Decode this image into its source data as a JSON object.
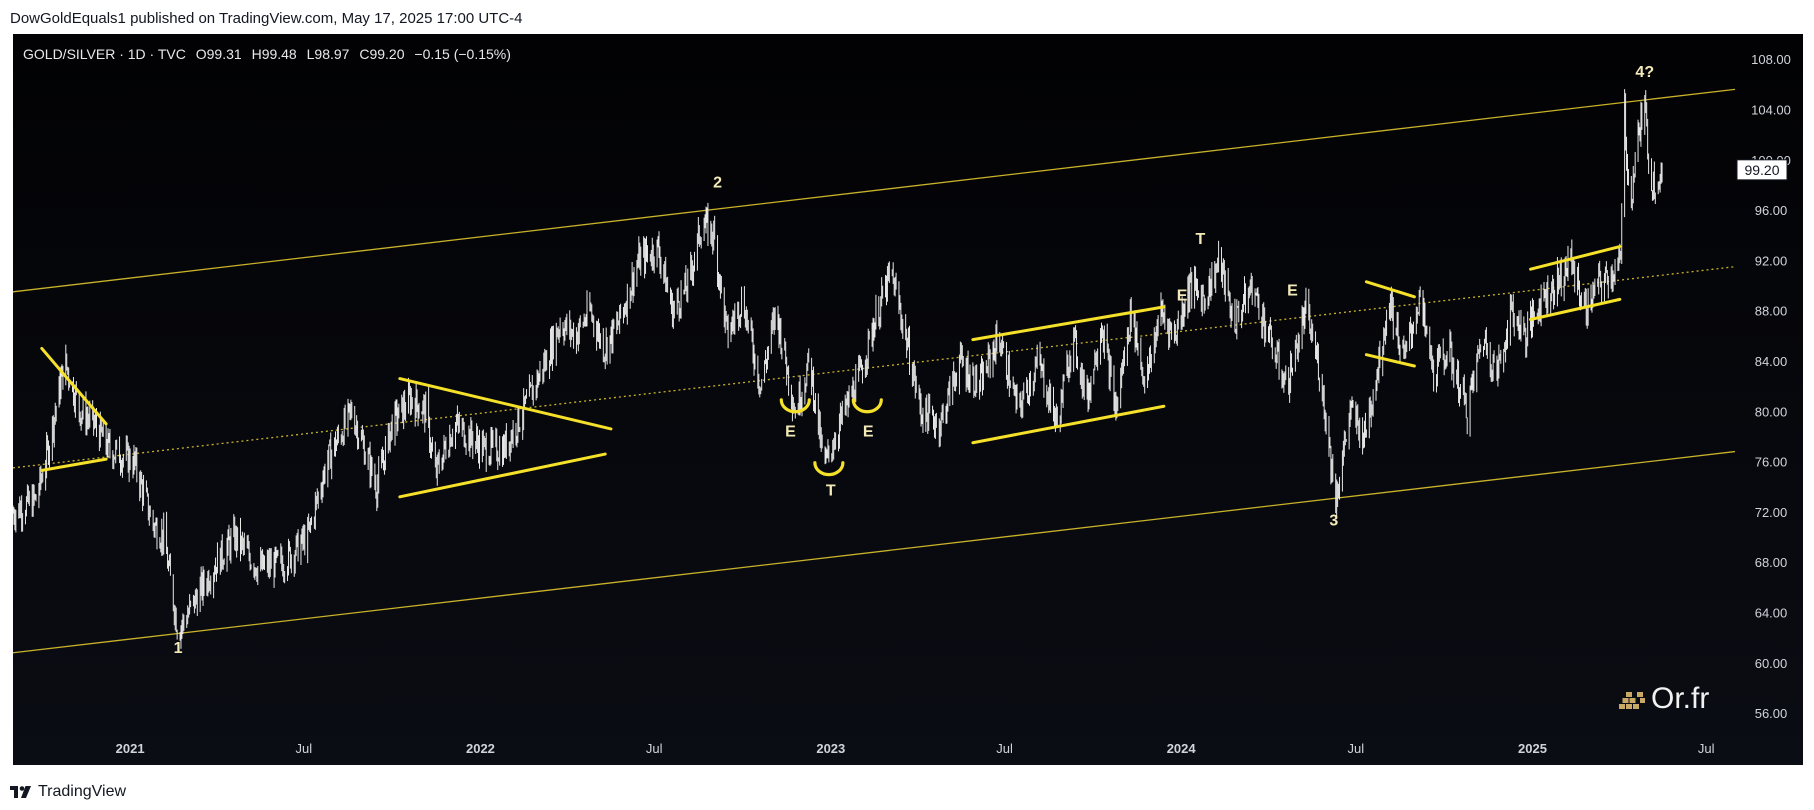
{
  "header": {
    "published_text": "DowGoldEquals1 published on TradingView.com, May 17, 2025 17:00 UTC-4"
  },
  "legend": {
    "symbol": "GOLD/SILVER · 1D · TVC",
    "open": "O99.31",
    "high": "H99.48",
    "low": "L98.97",
    "close": "C99.20",
    "change": "−0.15 (−0.15%)"
  },
  "last_price": "99.20",
  "footer": {
    "brand": "TradingView"
  },
  "watermark": {
    "text": "Or.fr"
  },
  "colors": {
    "background": "#05060a",
    "candle": "#e8e8e8",
    "channel": "#c8b22a",
    "pattern": "#f5e02a",
    "label": "#f3eab8"
  },
  "chart_data": {
    "type": "line",
    "title": "GOLD/SILVER · 1D · TVC",
    "ylim": [
      54.5,
      110
    ],
    "xlim": [
      "2020-09-01",
      "2025-07-31"
    ],
    "y_ticks": [
      "56.00",
      "60.00",
      "64.00",
      "68.00",
      "72.00",
      "76.00",
      "80.00",
      "84.00",
      "88.00",
      "92.00",
      "96.00",
      "100.00",
      "104.00",
      "108.00"
    ],
    "x_ticks": [
      {
        "label": "2021",
        "date": "2021-01-01",
        "bold": true
      },
      {
        "label": "Jul",
        "date": "2021-07-01",
        "bold": false
      },
      {
        "label": "2022",
        "date": "2022-01-01",
        "bold": true
      },
      {
        "label": "Jul",
        "date": "2022-07-01",
        "bold": false
      },
      {
        "label": "2023",
        "date": "2023-01-01",
        "bold": true
      },
      {
        "label": "Jul",
        "date": "2023-07-01",
        "bold": false
      },
      {
        "label": "2024",
        "date": "2024-01-01",
        "bold": true
      },
      {
        "label": "Jul",
        "date": "2024-07-01",
        "bold": false
      },
      {
        "label": "2025",
        "date": "2025-01-01",
        "bold": true
      },
      {
        "label": "Jul",
        "date": "2025-07-01",
        "bold": false
      }
    ],
    "series": [
      {
        "x": [
          "2020-09-01",
          "2020-09-25",
          "2020-10-05",
          "2020-10-25",
          "2020-11-10",
          "2020-11-25",
          "2020-12-10",
          "2021-01-05",
          "2021-01-25",
          "2021-02-05",
          "2021-02-20",
          "2021-03-10",
          "2021-04-01",
          "2021-04-20",
          "2021-05-15",
          "2021-06-10",
          "2021-07-05",
          "2021-07-25",
          "2021-08-20",
          "2021-09-15",
          "2021-10-01",
          "2021-10-20",
          "2021-11-05",
          "2021-11-15",
          "2021-12-05",
          "2022-01-05",
          "2022-01-25",
          "2022-02-15",
          "2022-03-10",
          "2022-03-25",
          "2022-04-10",
          "2022-04-25",
          "2022-05-10",
          "2022-05-25",
          "2022-06-15",
          "2022-07-05",
          "2022-07-20",
          "2022-08-05",
          "2022-08-20",
          "2022-09-01",
          "2022-09-15",
          "2022-10-01",
          "2022-10-20",
          "2022-11-05",
          "2022-11-25",
          "2022-12-10",
          "2022-12-25",
          "2023-01-10",
          "2023-02-01",
          "2023-02-15",
          "2023-03-05",
          "2023-03-20",
          "2023-04-05",
          "2023-04-25",
          "2023-05-15",
          "2023-06-05",
          "2023-06-25",
          "2023-07-15",
          "2023-08-05",
          "2023-08-25",
          "2023-09-10",
          "2023-09-25",
          "2023-10-10",
          "2023-10-25",
          "2023-11-10",
          "2023-11-25",
          "2023-12-10",
          "2023-12-25",
          "2024-01-10",
          "2024-01-25",
          "2024-02-10",
          "2024-02-25",
          "2024-03-15",
          "2024-04-01",
          "2024-04-20",
          "2024-05-10",
          "2024-05-25",
          "2024-06-10",
          "2024-06-25",
          "2024-07-10",
          "2024-07-25",
          "2024-08-05",
          "2024-08-20",
          "2024-09-05",
          "2024-09-20",
          "2024-10-05",
          "2024-10-25",
          "2024-11-10",
          "2024-11-25",
          "2024-12-10",
          "2024-12-25",
          "2025-01-10",
          "2025-01-25",
          "2025-02-10",
          "2025-02-25",
          "2025-03-10",
          "2025-03-25",
          "2025-04-03",
          "2025-04-07",
          "2025-04-12",
          "2025-04-21",
          "2025-04-28",
          "2025-05-05",
          "2025-05-16"
        ],
        "y": [
          72,
          73,
          76,
          84,
          80,
          79,
          77,
          76,
          71,
          70,
          62.5,
          65,
          68,
          70,
          67.5,
          68,
          70,
          76,
          80,
          74,
          79,
          81,
          80,
          75,
          79,
          77,
          77,
          80,
          84,
          87,
          86,
          88,
          85,
          87,
          92,
          93,
          88,
          90,
          95,
          94,
          86,
          89,
          82,
          88,
          80,
          84,
          75.5,
          79,
          83,
          87,
          91,
          86,
          80,
          79,
          84,
          82,
          86,
          80,
          84,
          79,
          86,
          81,
          87,
          80,
          88,
          82,
          88,
          86,
          90,
          89,
          92,
          87,
          90,
          86,
          82,
          88,
          83,
          73,
          80,
          78,
          84,
          89,
          84,
          89,
          83,
          85,
          80,
          86,
          83,
          88,
          86,
          89,
          90,
          92,
          88,
          90,
          91,
          92,
          104,
          96,
          102,
          104,
          98,
          99.2
        ]
      }
    ],
    "channel_lines": [
      {
        "from": [
          "2020-09-01",
          60.8
        ],
        "to": [
          "2025-07-31",
          76.8
        ]
      },
      {
        "from": [
          "2020-09-01",
          75.5
        ],
        "to": [
          "2025-07-31",
          91.5
        ]
      },
      {
        "from": [
          "2020-09-01",
          89.5
        ],
        "to": [
          "2025-07-31",
          105.6
        ]
      }
    ],
    "pattern_lines": [
      {
        "from": [
          "2020-10-01",
          85.0
        ],
        "to": [
          "2020-12-07",
          79.0
        ]
      },
      {
        "from": [
          "2020-10-01",
          75.3
        ],
        "to": [
          "2020-12-07",
          76.2
        ]
      },
      {
        "from": [
          "2021-10-09",
          82.6
        ],
        "to": [
          "2022-05-17",
          78.6
        ]
      },
      {
        "from": [
          "2021-10-09",
          73.2
        ],
        "to": [
          "2022-05-11",
          76.6
        ]
      },
      {
        "from": [
          "2023-05-29",
          85.7
        ],
        "to": [
          "2023-12-14",
          88.3
        ]
      },
      {
        "from": [
          "2023-05-29",
          77.5
        ],
        "to": [
          "2023-12-14",
          80.4
        ]
      },
      {
        "from": [
          "2024-07-12",
          90.3
        ],
        "to": [
          "2024-08-31",
          89.1
        ]
      },
      {
        "from": [
          "2024-07-12",
          84.5
        ],
        "to": [
          "2024-08-31",
          83.6
        ]
      },
      {
        "from": [
          "2024-12-30",
          91.3
        ],
        "to": [
          "2025-04-02",
          93.1
        ]
      },
      {
        "from": [
          "2024-12-30",
          87.3
        ],
        "to": [
          "2025-04-02",
          88.9
        ]
      }
    ],
    "arcs": [
      {
        "center": [
          "2022-11-25",
          80.3
        ],
        "dir": "up"
      },
      {
        "center": [
          "2022-12-30",
          75.3
        ],
        "dir": "up"
      },
      {
        "center": [
          "2023-02-08",
          80.3
        ],
        "dir": "up"
      }
    ],
    "annotations": [
      {
        "text": "1",
        "x": "2021-02-20",
        "y": 60.8
      },
      {
        "text": "2",
        "x": "2022-09-05",
        "y": 97.8
      },
      {
        "text": "T",
        "x": "2023-01-01",
        "y": 73.3
      },
      {
        "text": "E",
        "x": "2022-11-20",
        "y": 78.0
      },
      {
        "text": "E",
        "x": "2023-02-09",
        "y": 78.0
      },
      {
        "text": "E",
        "x": "2024-01-02",
        "y": 88.8
      },
      {
        "text": "T",
        "x": "2024-01-21",
        "y": 93.3
      },
      {
        "text": "E",
        "x": "2024-04-26",
        "y": 89.2
      },
      {
        "text": "3",
        "x": "2024-06-08",
        "y": 70.9
      },
      {
        "text": "4?",
        "x": "2025-04-28",
        "y": 106.6
      }
    ]
  }
}
